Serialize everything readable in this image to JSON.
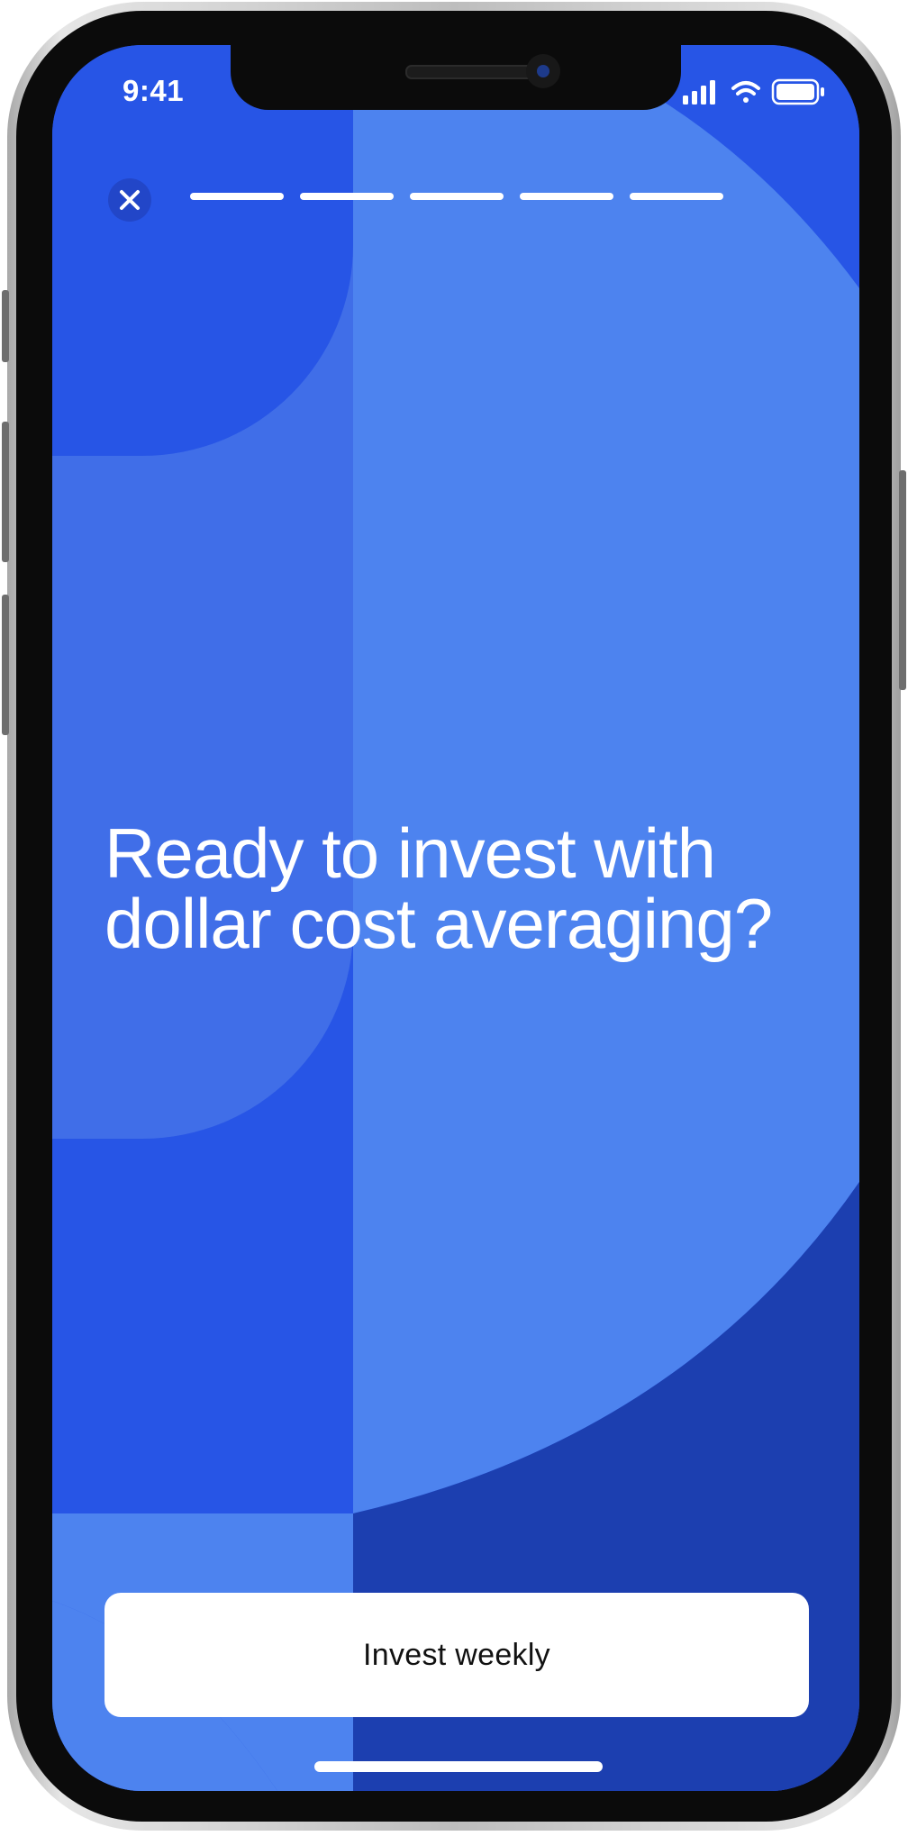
{
  "status_bar": {
    "time": "9:41",
    "icons": [
      "signal-icon",
      "wifi-icon",
      "battery-icon"
    ]
  },
  "header": {
    "close_icon": "close-icon",
    "progress": {
      "total_steps": 5,
      "completed_steps": 5
    }
  },
  "content": {
    "headline_line1": "Ready to invest with",
    "headline_line2": "dollar cost averaging?"
  },
  "cta": {
    "label": "Invest weekly"
  },
  "colors": {
    "background_dark": "#2755e6",
    "background_light": "#4d83ef",
    "panel_mid": "#406ee8",
    "navy": "#1c3fb0",
    "button_bg": "#ffffff",
    "button_text": "#111111",
    "text": "#ffffff"
  }
}
